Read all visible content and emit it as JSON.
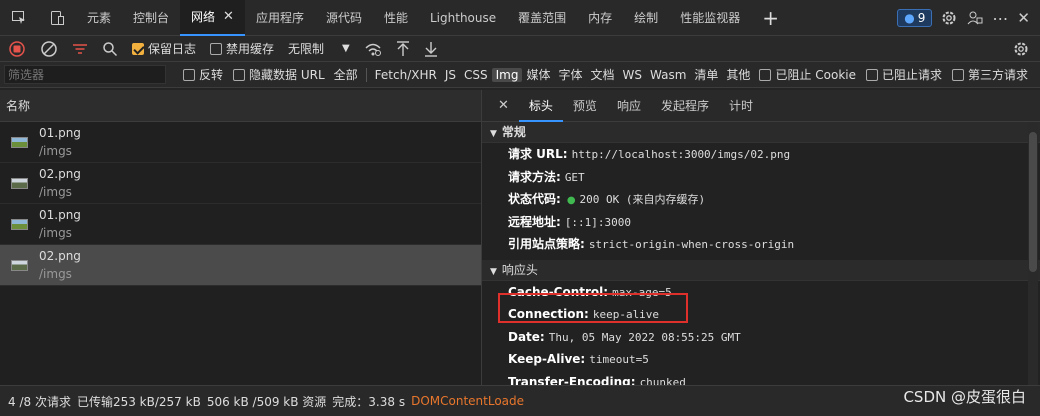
{
  "tabs": [
    {
      "label": "元素"
    },
    {
      "label": "控制台"
    },
    {
      "label": "网络"
    },
    {
      "label": "应用程序"
    },
    {
      "label": "源代码"
    },
    {
      "label": "性能"
    },
    {
      "label": "Lighthouse"
    },
    {
      "label": "覆盖范围"
    },
    {
      "label": "内存"
    },
    {
      "label": "绘制"
    },
    {
      "label": "性能监视器"
    }
  ],
  "issues_badge": "9",
  "toolbar": {
    "preserve_log": "保留日志",
    "disable_cache": "禁用缓存",
    "throttling": "无限制"
  },
  "filter": {
    "placeholder": "筛选器",
    "invert": "反转",
    "hide_data_urls": "隐藏数据 URL",
    "types": [
      "全部",
      "Fetch/XHR",
      "JS",
      "CSS",
      "Img",
      "媒体",
      "字体",
      "文档",
      "WS",
      "Wasm",
      "清单",
      "其他"
    ],
    "blocked_cookies": "已阻止 Cookie",
    "blocked_requests": "已阻止请求",
    "third_party": "第三方请求"
  },
  "requests": {
    "column_name": "名称",
    "items": [
      {
        "name": "01.png",
        "path": "/imgs"
      },
      {
        "name": "02.png",
        "path": "/imgs"
      },
      {
        "name": "01.png",
        "path": "/imgs"
      },
      {
        "name": "02.png",
        "path": "/imgs"
      }
    ]
  },
  "detail": {
    "tabs": [
      "标头",
      "预览",
      "响应",
      "发起程序",
      "计时"
    ],
    "general_title": "常规",
    "general": [
      {
        "k": "请求 URL:",
        "v": "http://localhost:3000/imgs/02.png"
      },
      {
        "k": "请求方法:",
        "v": "GET"
      },
      {
        "k": "状态代码:",
        "v": "200 OK (来自内存缓存)"
      },
      {
        "k": "远程地址:",
        "v": "[::1]:3000"
      },
      {
        "k": "引用站点策略:",
        "v": "strict-origin-when-cross-origin"
      }
    ],
    "response_title": "响应头",
    "response": [
      {
        "k": "Cache-Control:",
        "v": "max-age=5"
      },
      {
        "k": "Connection:",
        "v": "keep-alive"
      },
      {
        "k": "Date:",
        "v": "Thu, 05 May 2022 08:55:25 GMT"
      },
      {
        "k": "Keep-Alive:",
        "v": "timeout=5"
      },
      {
        "k": "Transfer-Encoding:",
        "v": "chunked"
      }
    ]
  },
  "status": {
    "requests": "4 /8 次请求",
    "transferred": "已传输253 kB/257 kB",
    "resources": "506 kB /509 kB 资源",
    "finish": "完成：3.38 s",
    "dom": "DOMContentLoade"
  },
  "watermark": "CSDN @皮蛋很白",
  "colors": {
    "accent": "#3794ff",
    "record": "#e5534b",
    "checkbox": "#f2b03f",
    "highlight": "#e0302c"
  }
}
